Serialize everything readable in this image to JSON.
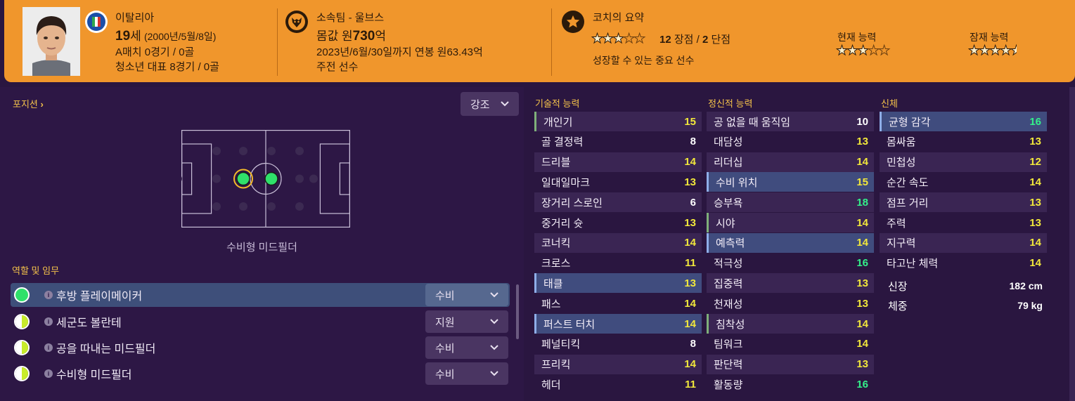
{
  "header": {
    "nationality": "이탈리아",
    "age_value": "19",
    "age_unit": "세",
    "birthdate": "(2000년/5월/8일)",
    "caps": "A매치 0경기 / 0골",
    "youth_caps": "청소년 대표 8경기 / 0골",
    "club": "소속팀 - 울브스",
    "value_prefix": "몸값 원",
    "value_amount": "730",
    "value_unit": "억",
    "contract": "2023년/6월/30일까지 연봉 원63.43억",
    "squad_status": "주전 선수",
    "coach_title": "코치의 요약",
    "strengths_count": "12",
    "strengths_label": "장점 /",
    "weaknesses_count": "2",
    "weaknesses_label": "단점",
    "coach_comment": "성장할 수 있는 중요 선수",
    "current_ability_label": "현재 능력",
    "potential_ability_label": "잠재 능력",
    "coach_stars": 3,
    "current_ability_stars": 3,
    "potential_ability_stars": 4.5
  },
  "positions": {
    "title": "포지션",
    "emphasis_label": "강조",
    "position_name": "수비형 미드필더"
  },
  "roles": {
    "title": "역할 및 임무",
    "items": [
      {
        "name": "후방 플레이메이커",
        "duty": "수비"
      },
      {
        "name": "세군도 볼란테",
        "duty": "지원"
      },
      {
        "name": "공을 따내는 미드필더",
        "duty": "수비"
      },
      {
        "name": "수비형 미드필더",
        "duty": "수비"
      }
    ]
  },
  "attributes": {
    "technical_title": "기술적 능력",
    "mental_title": "정신적 능력",
    "physical_title": "신체",
    "technical": [
      {
        "name": "개인기",
        "value": "15"
      },
      {
        "name": "골 결정력",
        "value": "8"
      },
      {
        "name": "드리블",
        "value": "14"
      },
      {
        "name": "일대일마크",
        "value": "13"
      },
      {
        "name": "장거리 스로인",
        "value": "6"
      },
      {
        "name": "중거리 슛",
        "value": "13"
      },
      {
        "name": "코너킥",
        "value": "14"
      },
      {
        "name": "크로스",
        "value": "11"
      },
      {
        "name": "태클",
        "value": "13"
      },
      {
        "name": "패스",
        "value": "14"
      },
      {
        "name": "퍼스트 터치",
        "value": "14"
      },
      {
        "name": "페널티킥",
        "value": "8"
      },
      {
        "name": "프리킥",
        "value": "14"
      },
      {
        "name": "헤더",
        "value": "11"
      }
    ],
    "mental": [
      {
        "name": "공 없을 때 움직임",
        "value": "10"
      },
      {
        "name": "대담성",
        "value": "13"
      },
      {
        "name": "리더십",
        "value": "14"
      },
      {
        "name": "수비 위치",
        "value": "15"
      },
      {
        "name": "승부욕",
        "value": "18"
      },
      {
        "name": "시야",
        "value": "14"
      },
      {
        "name": "예측력",
        "value": "14"
      },
      {
        "name": "적극성",
        "value": "16"
      },
      {
        "name": "집중력",
        "value": "13"
      },
      {
        "name": "천재성",
        "value": "13"
      },
      {
        "name": "침착성",
        "value": "14"
      },
      {
        "name": "팀워크",
        "value": "14"
      },
      {
        "name": "판단력",
        "value": "13"
      },
      {
        "name": "활동량",
        "value": "16"
      }
    ],
    "physical": [
      {
        "name": "균형 감각",
        "value": "16"
      },
      {
        "name": "몸싸움",
        "value": "13"
      },
      {
        "name": "민첩성",
        "value": "12"
      },
      {
        "name": "순간 속도",
        "value": "14"
      },
      {
        "name": "점프 거리",
        "value": "13"
      },
      {
        "name": "주력",
        "value": "13"
      },
      {
        "name": "지구력",
        "value": "14"
      },
      {
        "name": "타고난 체력",
        "value": "14"
      }
    ],
    "height_label": "신장",
    "height_value": "182 cm",
    "weight_label": "체중",
    "weight_value": "79 kg"
  }
}
